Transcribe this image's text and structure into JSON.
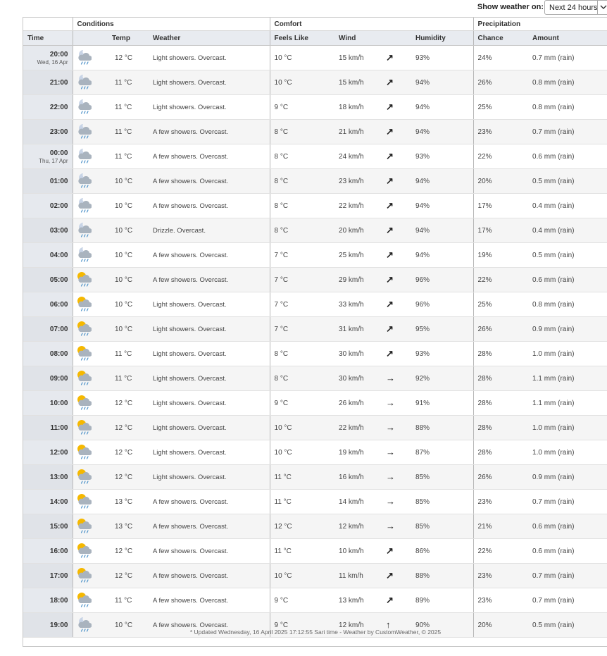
{
  "controls": {
    "show_label": "Show weather on:",
    "selected_period": "Next 24 hours"
  },
  "groups": {
    "conditions": "Conditions",
    "comfort": "Comfort",
    "precipitation": "Precipitation"
  },
  "headers": {
    "time": "Time",
    "temp": "Temp",
    "weather": "Weather",
    "feels_like": "Feels Like",
    "wind": "Wind",
    "humidity": "Humidity",
    "chance": "Chance",
    "amount": "Amount"
  },
  "rows": [
    {
      "time": "20:00",
      "date": "Wed, 16 Apr",
      "icon": "night-showers-icon",
      "temp": "12 °C",
      "weather": "Light showers. Overcast.",
      "feels": "10 °C",
      "wind": "15 km/h",
      "dir": "↗",
      "humidity": "93%",
      "chance": "24%",
      "amount": "0.7 mm (rain)"
    },
    {
      "time": "21:00",
      "date": "",
      "icon": "night-showers-icon",
      "temp": "11 °C",
      "weather": "Light showers. Overcast.",
      "feels": "10 °C",
      "wind": "15 km/h",
      "dir": "↗",
      "humidity": "94%",
      "chance": "26%",
      "amount": "0.8 mm (rain)"
    },
    {
      "time": "22:00",
      "date": "",
      "icon": "night-showers-icon",
      "temp": "11 °C",
      "weather": "Light showers. Overcast.",
      "feels": "9 °C",
      "wind": "18 km/h",
      "dir": "↗",
      "humidity": "94%",
      "chance": "25%",
      "amount": "0.8 mm (rain)"
    },
    {
      "time": "23:00",
      "date": "",
      "icon": "night-showers-icon",
      "temp": "11 °C",
      "weather": "A few showers. Overcast.",
      "feels": "8 °C",
      "wind": "21 km/h",
      "dir": "↗",
      "humidity": "94%",
      "chance": "23%",
      "amount": "0.7 mm (rain)"
    },
    {
      "time": "00:00",
      "date": "Thu, 17 Apr",
      "icon": "night-showers-icon",
      "temp": "11 °C",
      "weather": "A few showers. Overcast.",
      "feels": "8 °C",
      "wind": "24 km/h",
      "dir": "↗",
      "humidity": "93%",
      "chance": "22%",
      "amount": "0.6 mm (rain)"
    },
    {
      "time": "01:00",
      "date": "",
      "icon": "night-showers-icon",
      "temp": "10 °C",
      "weather": "A few showers. Overcast.",
      "feels": "8 °C",
      "wind": "23 km/h",
      "dir": "↗",
      "humidity": "94%",
      "chance": "20%",
      "amount": "0.5 mm (rain)"
    },
    {
      "time": "02:00",
      "date": "",
      "icon": "night-showers-icon",
      "temp": "10 °C",
      "weather": "A few showers. Overcast.",
      "feels": "8 °C",
      "wind": "22 km/h",
      "dir": "↗",
      "humidity": "94%",
      "chance": "17%",
      "amount": "0.4 mm (rain)"
    },
    {
      "time": "03:00",
      "date": "",
      "icon": "night-showers-icon",
      "temp": "10 °C",
      "weather": "Drizzle. Overcast.",
      "feels": "8 °C",
      "wind": "20 km/h",
      "dir": "↗",
      "humidity": "94%",
      "chance": "17%",
      "amount": "0.4 mm (rain)"
    },
    {
      "time": "04:00",
      "date": "",
      "icon": "night-showers-icon",
      "temp": "10 °C",
      "weather": "A few showers. Overcast.",
      "feels": "7 °C",
      "wind": "25 km/h",
      "dir": "↗",
      "humidity": "94%",
      "chance": "19%",
      "amount": "0.5 mm (rain)"
    },
    {
      "time": "05:00",
      "date": "",
      "icon": "day-showers-icon",
      "temp": "10 °C",
      "weather": "A few showers. Overcast.",
      "feels": "7 °C",
      "wind": "29 km/h",
      "dir": "↗",
      "humidity": "96%",
      "chance": "22%",
      "amount": "0.6 mm (rain)"
    },
    {
      "time": "06:00",
      "date": "",
      "icon": "day-showers-icon",
      "temp": "10 °C",
      "weather": "Light showers. Overcast.",
      "feels": "7 °C",
      "wind": "33 km/h",
      "dir": "↗",
      "humidity": "96%",
      "chance": "25%",
      "amount": "0.8 mm (rain)"
    },
    {
      "time": "07:00",
      "date": "",
      "icon": "day-showers-icon",
      "temp": "10 °C",
      "weather": "Light showers. Overcast.",
      "feels": "7 °C",
      "wind": "31 km/h",
      "dir": "↗",
      "humidity": "95%",
      "chance": "26%",
      "amount": "0.9 mm (rain)"
    },
    {
      "time": "08:00",
      "date": "",
      "icon": "day-showers-icon",
      "temp": "11 °C",
      "weather": "Light showers. Overcast.",
      "feels": "8 °C",
      "wind": "30 km/h",
      "dir": "↗",
      "humidity": "93%",
      "chance": "28%",
      "amount": "1.0 mm (rain)"
    },
    {
      "time": "09:00",
      "date": "",
      "icon": "day-showers-icon",
      "temp": "11 °C",
      "weather": "Light showers. Overcast.",
      "feels": "8 °C",
      "wind": "30 km/h",
      "dir": "→",
      "humidity": "92%",
      "chance": "28%",
      "amount": "1.1 mm (rain)"
    },
    {
      "time": "10:00",
      "date": "",
      "icon": "day-showers-icon",
      "temp": "12 °C",
      "weather": "Light showers. Overcast.",
      "feels": "9 °C",
      "wind": "26 km/h",
      "dir": "→",
      "humidity": "91%",
      "chance": "28%",
      "amount": "1.1 mm (rain)"
    },
    {
      "time": "11:00",
      "date": "",
      "icon": "day-showers-icon",
      "temp": "12 °C",
      "weather": "Light showers. Overcast.",
      "feels": "10 °C",
      "wind": "22 km/h",
      "dir": "→",
      "humidity": "88%",
      "chance": "28%",
      "amount": "1.0 mm (rain)"
    },
    {
      "time": "12:00",
      "date": "",
      "icon": "day-showers-icon",
      "temp": "12 °C",
      "weather": "Light showers. Overcast.",
      "feels": "10 °C",
      "wind": "19 km/h",
      "dir": "→",
      "humidity": "87%",
      "chance": "28%",
      "amount": "1.0 mm (rain)"
    },
    {
      "time": "13:00",
      "date": "",
      "icon": "day-showers-icon",
      "temp": "12 °C",
      "weather": "Light showers. Overcast.",
      "feels": "11 °C",
      "wind": "16 km/h",
      "dir": "→",
      "humidity": "85%",
      "chance": "26%",
      "amount": "0.9 mm (rain)"
    },
    {
      "time": "14:00",
      "date": "",
      "icon": "day-showers-icon",
      "temp": "13 °C",
      "weather": "A few showers. Overcast.",
      "feels": "11 °C",
      "wind": "14 km/h",
      "dir": "→",
      "humidity": "85%",
      "chance": "23%",
      "amount": "0.7 mm (rain)"
    },
    {
      "time": "15:00",
      "date": "",
      "icon": "day-showers-icon",
      "temp": "13 °C",
      "weather": "A few showers. Overcast.",
      "feels": "12 °C",
      "wind": "12 km/h",
      "dir": "→",
      "humidity": "85%",
      "chance": "21%",
      "amount": "0.6 mm (rain)"
    },
    {
      "time": "16:00",
      "date": "",
      "icon": "day-showers-icon",
      "temp": "12 °C",
      "weather": "A few showers. Overcast.",
      "feels": "11 °C",
      "wind": "10 km/h",
      "dir": "↗",
      "humidity": "86%",
      "chance": "22%",
      "amount": "0.6 mm (rain)"
    },
    {
      "time": "17:00",
      "date": "",
      "icon": "day-showers-icon",
      "temp": "12 °C",
      "weather": "A few showers. Overcast.",
      "feels": "10 °C",
      "wind": "11 km/h",
      "dir": "↗",
      "humidity": "88%",
      "chance": "23%",
      "amount": "0.7 mm (rain)"
    },
    {
      "time": "18:00",
      "date": "",
      "icon": "day-showers-icon",
      "temp": "11 °C",
      "weather": "A few showers. Overcast.",
      "feels": "9 °C",
      "wind": "13 km/h",
      "dir": "↗",
      "humidity": "89%",
      "chance": "23%",
      "amount": "0.7 mm (rain)"
    },
    {
      "time": "19:00",
      "date": "",
      "icon": "night-showers-icon",
      "temp": "10 °C",
      "weather": "A few showers. Overcast.",
      "feels": "9 °C",
      "wind": "12 km/h",
      "dir": "↑",
      "humidity": "90%",
      "chance": "20%",
      "amount": "0.5 mm (rain)"
    }
  ],
  "footer": "* Updated Wednesday, 16 April 2025 17:12:55 Sari time - Weather by CustomWeather, © 2025",
  "colors": {
    "sun": "#f5b800",
    "cloud": "#a9b3be",
    "moon": "#c8d4e6",
    "rain": "#4a90c8",
    "header_bg": "#e8ebf0"
  }
}
